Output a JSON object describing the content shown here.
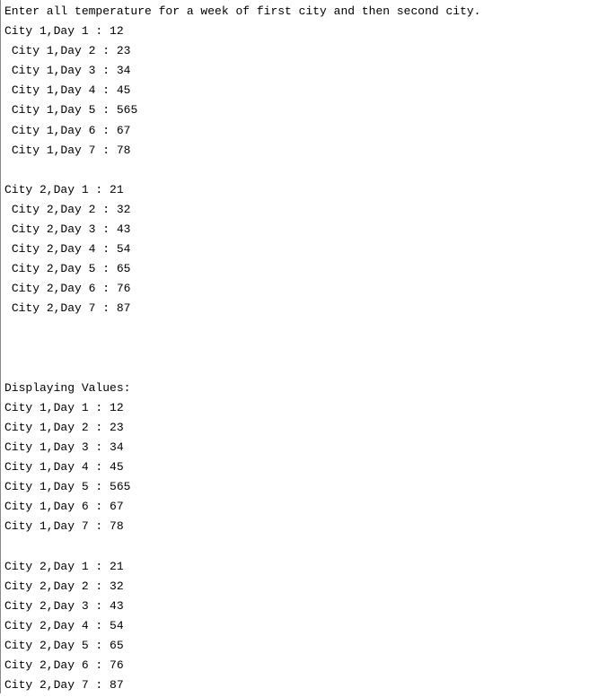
{
  "prompt": "Enter all temperature for a week of first city and then second city.",
  "input": {
    "city1": [
      {
        "label": "City 1,Day 1 : ",
        "value": "12",
        "indent": false
      },
      {
        "label": "City 1,Day 2 : ",
        "value": "23",
        "indent": true
      },
      {
        "label": "City 1,Day 3 : ",
        "value": "34",
        "indent": true
      },
      {
        "label": "City 1,Day 4 : ",
        "value": "45",
        "indent": true
      },
      {
        "label": "City 1,Day 5 : ",
        "value": "565",
        "indent": true
      },
      {
        "label": "City 1,Day 6 : ",
        "value": "67",
        "indent": true
      },
      {
        "label": "City 1,Day 7 : ",
        "value": "78",
        "indent": true
      }
    ],
    "city2": [
      {
        "label": "City 2,Day 1 : ",
        "value": "21",
        "indent": false
      },
      {
        "label": "City 2,Day 2 : ",
        "value": "32",
        "indent": true
      },
      {
        "label": "City 2,Day 3 : ",
        "value": "43",
        "indent": true
      },
      {
        "label": "City 2,Day 4 : ",
        "value": "54",
        "indent": true
      },
      {
        "label": "City 2,Day 5 : ",
        "value": "65",
        "indent": true
      },
      {
        "label": "City 2,Day 6 : ",
        "value": "76",
        "indent": true
      },
      {
        "label": "City 2,Day 7 : ",
        "value": "87",
        "indent": true
      }
    ]
  },
  "output_header": "Displaying Values:",
  "output": {
    "city1": [
      {
        "label": "City 1,Day 1 : ",
        "value": "12"
      },
      {
        "label": "City 1,Day 2 : ",
        "value": "23"
      },
      {
        "label": "City 1,Day 3 : ",
        "value": "34"
      },
      {
        "label": "City 1,Day 4 : ",
        "value": "45"
      },
      {
        "label": "City 1,Day 5 : ",
        "value": "565"
      },
      {
        "label": "City 1,Day 6 : ",
        "value": "67"
      },
      {
        "label": "City 1,Day 7 : ",
        "value": "78"
      }
    ],
    "city2": [
      {
        "label": "City 2,Day 1 : ",
        "value": "21"
      },
      {
        "label": "City 2,Day 2 : ",
        "value": "32"
      },
      {
        "label": "City 2,Day 3 : ",
        "value": "43"
      },
      {
        "label": "City 2,Day 4 : ",
        "value": "54"
      },
      {
        "label": "City 2,Day 5 : ",
        "value": "65"
      },
      {
        "label": "City 2,Day 6 : ",
        "value": "76"
      },
      {
        "label": "City 2,Day 7 : ",
        "value": "87"
      }
    ]
  }
}
